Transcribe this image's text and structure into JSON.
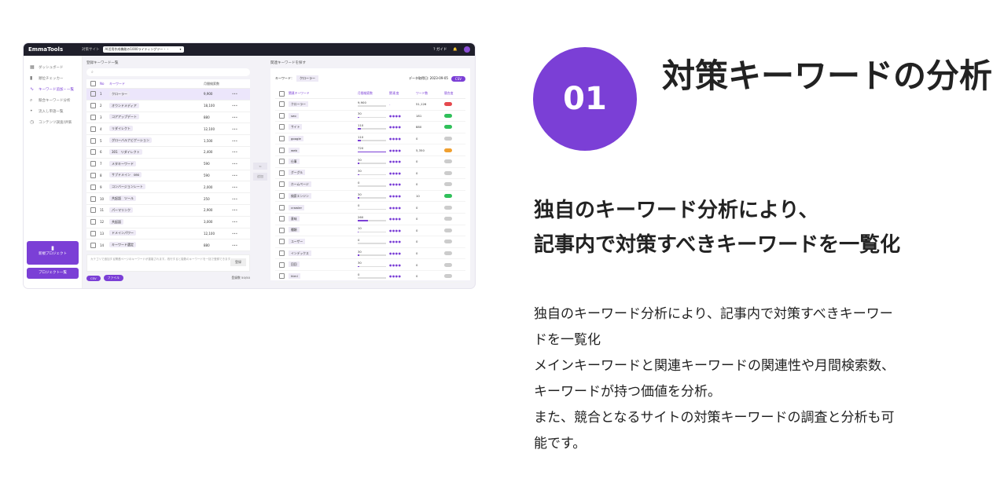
{
  "app": {
    "logo": "EmmaTools",
    "site_label": "対策サイト",
    "site_value": "AI活用作成機能の1000ライティングツー・・",
    "guide": "ガイド"
  },
  "sidebar": {
    "items": [
      {
        "label": "ダッシュボード",
        "icon": "grid-icon"
      },
      {
        "label": "順位チェッカー",
        "icon": "bar-chart-icon"
      },
      {
        "label": "キーワード追加・一覧",
        "icon": "trend-icon"
      },
      {
        "label": "競合キーワード分析",
        "icon": "search-icon"
      },
      {
        "label": "流入し単語一覧",
        "icon": "dot-icon"
      },
      {
        "label": "コンテンツ調査/評価",
        "icon": "clock-icon"
      }
    ],
    "new_project": "新規プロジェクト",
    "project_list": "プロジェクト一覧"
  },
  "left_panel": {
    "title": "登録キーワード一覧",
    "search_placeholder": "",
    "headers": {
      "no": "No",
      "keyword": "キーワード",
      "volume": "月間検索数"
    },
    "rows": [
      {
        "no": "1",
        "kw": "クローラー",
        "vol": "9,900"
      },
      {
        "no": "2",
        "kw": "オウンドメディア",
        "vol": "18,100"
      },
      {
        "no": "3",
        "kw": "コアアップデート",
        "vol": "880"
      },
      {
        "no": "4",
        "kw": "リダイレクト",
        "vol": "12,100"
      },
      {
        "no": "5",
        "kw": "グローバルナビゲーション",
        "vol": "1,500"
      },
      {
        "no": "6",
        "kw": "301　リダイレクト",
        "vol": "2,400"
      },
      {
        "no": "7",
        "kw": "メタキーワード",
        "vol": "590"
      },
      {
        "no": "8",
        "kw": "サブドメイン　seo",
        "vol": "590"
      },
      {
        "no": "9",
        "kw": "コンバージョンレート",
        "vol": "2,000"
      },
      {
        "no": "10",
        "kw": "共起語　ツール",
        "vol": "250"
      },
      {
        "no": "11",
        "kw": "パーマリンク",
        "vol": "2,900"
      },
      {
        "no": "12",
        "kw": "共起語",
        "vol": "3,000"
      },
      {
        "no": "13",
        "kw": "ドメインパワー",
        "vol": "12,100"
      },
      {
        "no": "14",
        "kw": "キーワード選定",
        "vol": "880"
      }
    ],
    "input_hint": "カテゴリで追加する関連ページのキーワードが重複されます。改行すると複数のキーワードを一括で登録できます。",
    "add_label": "登録",
    "csv_label": "CSV",
    "file_label": "ファイル",
    "count_label": "登録数 50/50"
  },
  "move": {
    "arrow": "⇐",
    "label": "追加"
  },
  "right_panel": {
    "title": "関連キーワードを探す",
    "keyword_label": "キーワード：",
    "keyword_value": "クローラー",
    "date_label": "データ取得日: 2023-09-05",
    "csv_label": "CSV",
    "headers": {
      "kw": "関連キーワード",
      "vol": "月間検索数",
      "rel": "関連度",
      "count": "ワード数",
      "status": "競合度"
    },
    "rows": [
      {
        "kw": "クローラー",
        "vol": "9,900",
        "fill": 0,
        "rel": "-",
        "count": "51,126",
        "status": "red"
      },
      {
        "kw": "seo",
        "vol": "30",
        "fill": 0.05,
        "rel": "●●●●",
        "count": "181",
        "status": "green"
      },
      {
        "kw": "サイト",
        "vol": "110",
        "fill": 0.1,
        "rel": "●●●●",
        "count": "880",
        "status": "green"
      },
      {
        "kw": "google",
        "vol": "110",
        "fill": 0.1,
        "rel": "●●●●",
        "count": "0",
        "status": "gray"
      },
      {
        "kw": "web",
        "vol": "720",
        "fill": 1,
        "rel": "●●●●",
        "count": "5,350",
        "status": "orange"
      },
      {
        "kw": "仕事",
        "vol": "30",
        "fill": 0.05,
        "rel": "●●●●",
        "count": "0",
        "status": "gray"
      },
      {
        "kw": "グーグル",
        "vol": "30",
        "fill": 0.05,
        "rel": "●●●●",
        "count": "0",
        "status": "gray"
      },
      {
        "kw": "ホームページ",
        "vol": "0",
        "fill": 0,
        "rel": "●●●●",
        "count": "0",
        "status": "gray"
      },
      {
        "kw": "検索エンジン",
        "vol": "30",
        "fill": 0.05,
        "rel": "●●●●",
        "count": "10",
        "status": "green"
      },
      {
        "kw": "crawler",
        "vol": "0",
        "fill": 0,
        "rel": "●●●●",
        "count": "0",
        "status": "gray"
      },
      {
        "kw": "意味",
        "vol": "260",
        "fill": 0.35,
        "rel": "●●●●",
        "count": "0",
        "status": "gray"
      },
      {
        "kw": "種類",
        "vol": "10",
        "fill": 0.02,
        "rel": "●●●●",
        "count": "0",
        "status": "gray"
      },
      {
        "kw": "ユーザー",
        "vol": "0",
        "fill": 0,
        "rel": "●●●●",
        "count": "0",
        "status": "gray"
      },
      {
        "kw": "インデックス",
        "vol": "30",
        "fill": 0.05,
        "rel": "●●●●",
        "count": "0",
        "status": "gray"
      },
      {
        "kw": "回回",
        "vol": "30",
        "fill": 0.05,
        "rel": "●●●●",
        "count": "0",
        "status": "gray"
      },
      {
        "kw": "html",
        "vol": "0",
        "fill": 0,
        "rel": "●●●●",
        "count": "0",
        "status": "gray"
      }
    ]
  },
  "feature": {
    "number": "01",
    "title": "対策キーワードの分析",
    "subtitle_line1": "独自のキーワード分析により、",
    "subtitle_line2": "記事内で対策すべきキーワードを一覧化",
    "body": [
      "独自のキーワード分析により、記事内で対策すべきキーワー",
      "ドを一覧化",
      "メインキーワードと関連キーワードの関連性や月間検索数、",
      "キーワードが持つ価値を分析。",
      "また、競合となるサイトの対策キーワードの調査と分析も可",
      "能です。"
    ]
  },
  "colors": {
    "accent": "#7b3fd6",
    "red": "#e5484d",
    "green": "#30c05a",
    "orange": "#f0a030",
    "gray": "#cccccc"
  }
}
